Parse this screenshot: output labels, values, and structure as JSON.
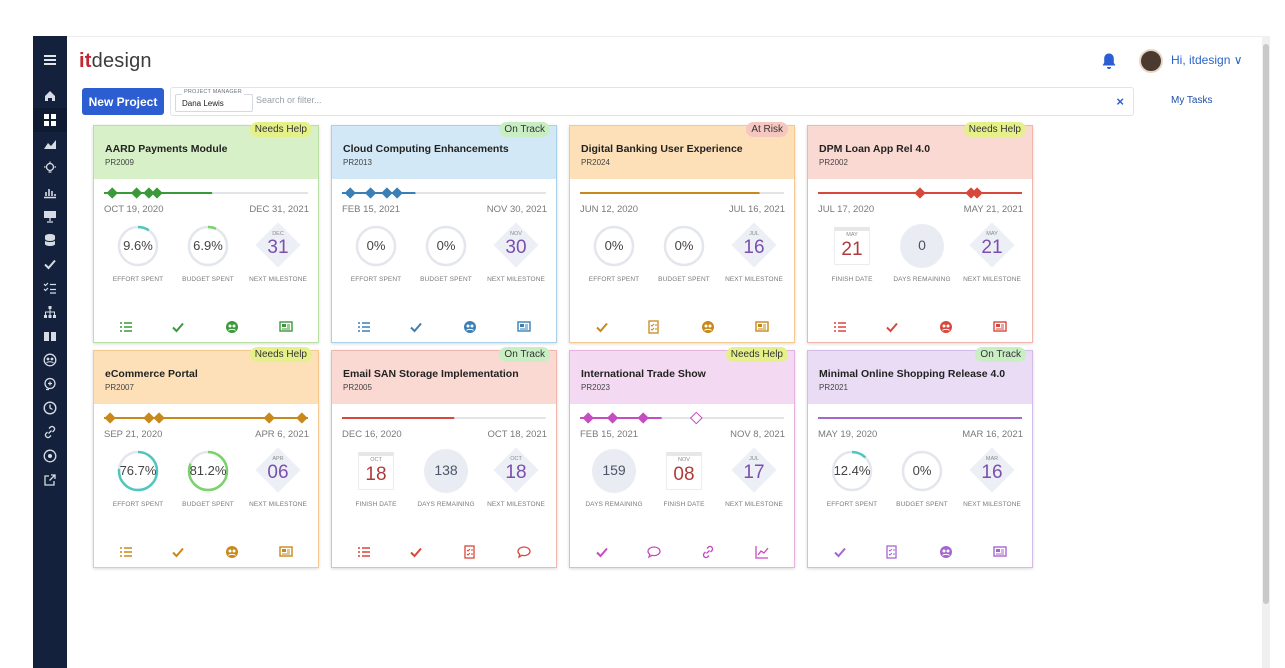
{
  "app": {
    "logo_it": "it",
    "logo_rest": "design",
    "greeting": "Hi, itdesign ∨"
  },
  "sidebar": {
    "icons": [
      "menu-icon",
      "home-icon",
      "dashboard-icon",
      "portfolio-icon",
      "ideas-icon",
      "reports-icon",
      "presentation-icon",
      "database-icon",
      "approvals-icon",
      "checklist-icon",
      "org-chart-icon",
      "library-icon",
      "resources-icon",
      "skills-icon",
      "timesheet-icon",
      "links-icon",
      "settings-icon",
      "export-icon"
    ]
  },
  "toolbar": {
    "new_project": "New Project",
    "pm_label": "PROJECT MANAGER",
    "pm_value": "Dana Lewis",
    "search_placeholder": "Search or filter...",
    "clear": "×",
    "my_tasks": "My Tasks"
  },
  "colors": {
    "green_head": "#d8f0c8",
    "blue_head": "#d3e8f6",
    "orange_head": "#fde0b8",
    "red_head": "#fbd9d3",
    "purple_head": "#eadcf4",
    "pink_head": "#f3d9f1"
  },
  "cards": [
    {
      "title": "AARD Payments Module",
      "code": "PR2009",
      "status": "Needs Help",
      "start": "OCT 19, 2020",
      "end": "DEC 31, 2021",
      "m1": {
        "value": "9.6%",
        "label": "EFFORT SPENT"
      },
      "m2": {
        "value": "6.9%",
        "label": "BUDGET SPENT"
      },
      "m3": {
        "mon": "DEC",
        "day": "31",
        "label": "NEXT MILESTONE"
      }
    },
    {
      "title": "Cloud Computing Enhancements",
      "code": "PR2013",
      "status": "On Track",
      "start": "FEB 15, 2021",
      "end": "NOV 30, 2021",
      "m1": {
        "value": "0%",
        "label": "EFFORT SPENT"
      },
      "m2": {
        "value": "0%",
        "label": "BUDGET SPENT"
      },
      "m3": {
        "mon": "NOV",
        "day": "30",
        "label": "NEXT MILESTONE"
      }
    },
    {
      "title": "Digital Banking User Experience",
      "code": "PR2024",
      "status": "At Risk",
      "start": "JUN 12, 2020",
      "end": "JUL 16, 2021",
      "m1": {
        "value": "0%",
        "label": "EFFORT SPENT"
      },
      "m2": {
        "value": "0%",
        "label": "BUDGET SPENT"
      },
      "m3": {
        "mon": "JUL",
        "day": "16",
        "label": "NEXT MILESTONE"
      }
    },
    {
      "title": "DPM Loan App Rel 4.0",
      "code": "PR2002",
      "status": "Needs Help",
      "start": "JUL 17, 2020",
      "end": "MAY 21, 2021",
      "m1": {
        "mon": "MAY",
        "day": "21",
        "label": "FINISH DATE"
      },
      "m2": {
        "value": "0",
        "label": "DAYS REMAINING"
      },
      "m3": {
        "mon": "MAY",
        "day": "21",
        "label": "NEXT MILESTONE"
      }
    },
    {
      "title": "eCommerce Portal",
      "code": "PR2007",
      "status": "Needs Help",
      "start": "SEP 21, 2020",
      "end": "APR 6, 2021",
      "m1": {
        "value": "76.7%",
        "label": "EFFORT SPENT"
      },
      "m2": {
        "value": "81.2%",
        "label": "BUDGET SPENT"
      },
      "m3": {
        "mon": "APR",
        "day": "06",
        "label": "NEXT MILESTONE"
      }
    },
    {
      "title": "Email SAN Storage Implementation",
      "code": "PR2005",
      "status": "On Track",
      "start": "DEC 16, 2020",
      "end": "OCT 18, 2021",
      "m1": {
        "mon": "OCT",
        "day": "18",
        "label": "FINISH DATE"
      },
      "m2": {
        "value": "138",
        "label": "DAYS REMAINING"
      },
      "m3": {
        "mon": "OCT",
        "day": "18",
        "label": "NEXT MILESTONE"
      }
    },
    {
      "title": "International Trade Show",
      "code": "PR2023",
      "status": "Needs Help",
      "start": "FEB 15, 2021",
      "end": "NOV 8, 2021",
      "m1": {
        "value": "159",
        "label": "DAYS REMAINING"
      },
      "m2": {
        "mon": "NOV",
        "day": "08",
        "label": "FINISH DATE"
      },
      "m3": {
        "mon": "JUL",
        "day": "17",
        "label": "NEXT MILESTONE"
      }
    },
    {
      "title": "Minimal Online Shopping Release 4.0",
      "code": "PR2021",
      "status": "On Track",
      "start": "MAY 19, 2020",
      "end": "MAR 16, 2021",
      "m1": {
        "value": "12.4%",
        "label": "EFFORT SPENT"
      },
      "m2": {
        "value": "0%",
        "label": "BUDGET SPENT"
      },
      "m3": {
        "mon": "MAR",
        "day": "16",
        "label": "NEXT MILESTONE"
      }
    }
  ]
}
